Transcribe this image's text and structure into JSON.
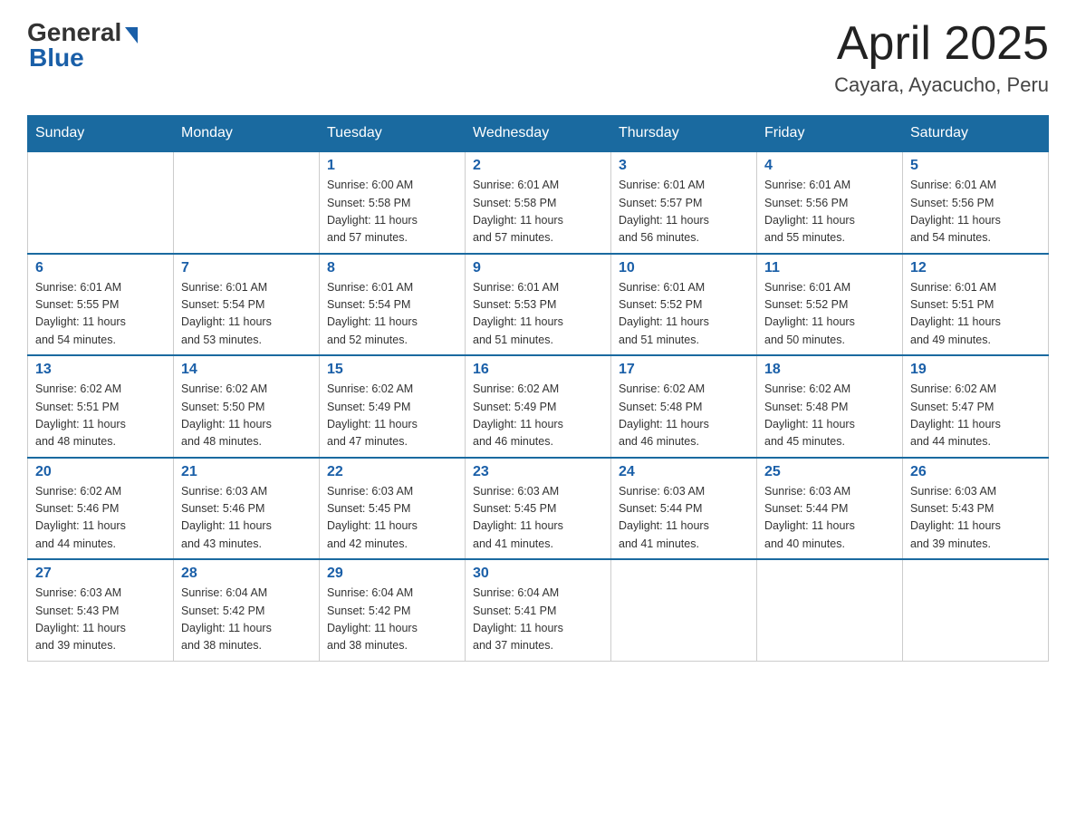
{
  "logo": {
    "general": "General",
    "blue": "Blue"
  },
  "header": {
    "month": "April 2025",
    "location": "Cayara, Ayacucho, Peru"
  },
  "weekdays": [
    "Sunday",
    "Monday",
    "Tuesday",
    "Wednesday",
    "Thursday",
    "Friday",
    "Saturday"
  ],
  "weeks": [
    [
      {
        "day": "",
        "info": ""
      },
      {
        "day": "",
        "info": ""
      },
      {
        "day": "1",
        "info": "Sunrise: 6:00 AM\nSunset: 5:58 PM\nDaylight: 11 hours\nand 57 minutes."
      },
      {
        "day": "2",
        "info": "Sunrise: 6:01 AM\nSunset: 5:58 PM\nDaylight: 11 hours\nand 57 minutes."
      },
      {
        "day": "3",
        "info": "Sunrise: 6:01 AM\nSunset: 5:57 PM\nDaylight: 11 hours\nand 56 minutes."
      },
      {
        "day": "4",
        "info": "Sunrise: 6:01 AM\nSunset: 5:56 PM\nDaylight: 11 hours\nand 55 minutes."
      },
      {
        "day": "5",
        "info": "Sunrise: 6:01 AM\nSunset: 5:56 PM\nDaylight: 11 hours\nand 54 minutes."
      }
    ],
    [
      {
        "day": "6",
        "info": "Sunrise: 6:01 AM\nSunset: 5:55 PM\nDaylight: 11 hours\nand 54 minutes."
      },
      {
        "day": "7",
        "info": "Sunrise: 6:01 AM\nSunset: 5:54 PM\nDaylight: 11 hours\nand 53 minutes."
      },
      {
        "day": "8",
        "info": "Sunrise: 6:01 AM\nSunset: 5:54 PM\nDaylight: 11 hours\nand 52 minutes."
      },
      {
        "day": "9",
        "info": "Sunrise: 6:01 AM\nSunset: 5:53 PM\nDaylight: 11 hours\nand 51 minutes."
      },
      {
        "day": "10",
        "info": "Sunrise: 6:01 AM\nSunset: 5:52 PM\nDaylight: 11 hours\nand 51 minutes."
      },
      {
        "day": "11",
        "info": "Sunrise: 6:01 AM\nSunset: 5:52 PM\nDaylight: 11 hours\nand 50 minutes."
      },
      {
        "day": "12",
        "info": "Sunrise: 6:01 AM\nSunset: 5:51 PM\nDaylight: 11 hours\nand 49 minutes."
      }
    ],
    [
      {
        "day": "13",
        "info": "Sunrise: 6:02 AM\nSunset: 5:51 PM\nDaylight: 11 hours\nand 48 minutes."
      },
      {
        "day": "14",
        "info": "Sunrise: 6:02 AM\nSunset: 5:50 PM\nDaylight: 11 hours\nand 48 minutes."
      },
      {
        "day": "15",
        "info": "Sunrise: 6:02 AM\nSunset: 5:49 PM\nDaylight: 11 hours\nand 47 minutes."
      },
      {
        "day": "16",
        "info": "Sunrise: 6:02 AM\nSunset: 5:49 PM\nDaylight: 11 hours\nand 46 minutes."
      },
      {
        "day": "17",
        "info": "Sunrise: 6:02 AM\nSunset: 5:48 PM\nDaylight: 11 hours\nand 46 minutes."
      },
      {
        "day": "18",
        "info": "Sunrise: 6:02 AM\nSunset: 5:48 PM\nDaylight: 11 hours\nand 45 minutes."
      },
      {
        "day": "19",
        "info": "Sunrise: 6:02 AM\nSunset: 5:47 PM\nDaylight: 11 hours\nand 44 minutes."
      }
    ],
    [
      {
        "day": "20",
        "info": "Sunrise: 6:02 AM\nSunset: 5:46 PM\nDaylight: 11 hours\nand 44 minutes."
      },
      {
        "day": "21",
        "info": "Sunrise: 6:03 AM\nSunset: 5:46 PM\nDaylight: 11 hours\nand 43 minutes."
      },
      {
        "day": "22",
        "info": "Sunrise: 6:03 AM\nSunset: 5:45 PM\nDaylight: 11 hours\nand 42 minutes."
      },
      {
        "day": "23",
        "info": "Sunrise: 6:03 AM\nSunset: 5:45 PM\nDaylight: 11 hours\nand 41 minutes."
      },
      {
        "day": "24",
        "info": "Sunrise: 6:03 AM\nSunset: 5:44 PM\nDaylight: 11 hours\nand 41 minutes."
      },
      {
        "day": "25",
        "info": "Sunrise: 6:03 AM\nSunset: 5:44 PM\nDaylight: 11 hours\nand 40 minutes."
      },
      {
        "day": "26",
        "info": "Sunrise: 6:03 AM\nSunset: 5:43 PM\nDaylight: 11 hours\nand 39 minutes."
      }
    ],
    [
      {
        "day": "27",
        "info": "Sunrise: 6:03 AM\nSunset: 5:43 PM\nDaylight: 11 hours\nand 39 minutes."
      },
      {
        "day": "28",
        "info": "Sunrise: 6:04 AM\nSunset: 5:42 PM\nDaylight: 11 hours\nand 38 minutes."
      },
      {
        "day": "29",
        "info": "Sunrise: 6:04 AM\nSunset: 5:42 PM\nDaylight: 11 hours\nand 38 minutes."
      },
      {
        "day": "30",
        "info": "Sunrise: 6:04 AM\nSunset: 5:41 PM\nDaylight: 11 hours\nand 37 minutes."
      },
      {
        "day": "",
        "info": ""
      },
      {
        "day": "",
        "info": ""
      },
      {
        "day": "",
        "info": ""
      }
    ]
  ]
}
